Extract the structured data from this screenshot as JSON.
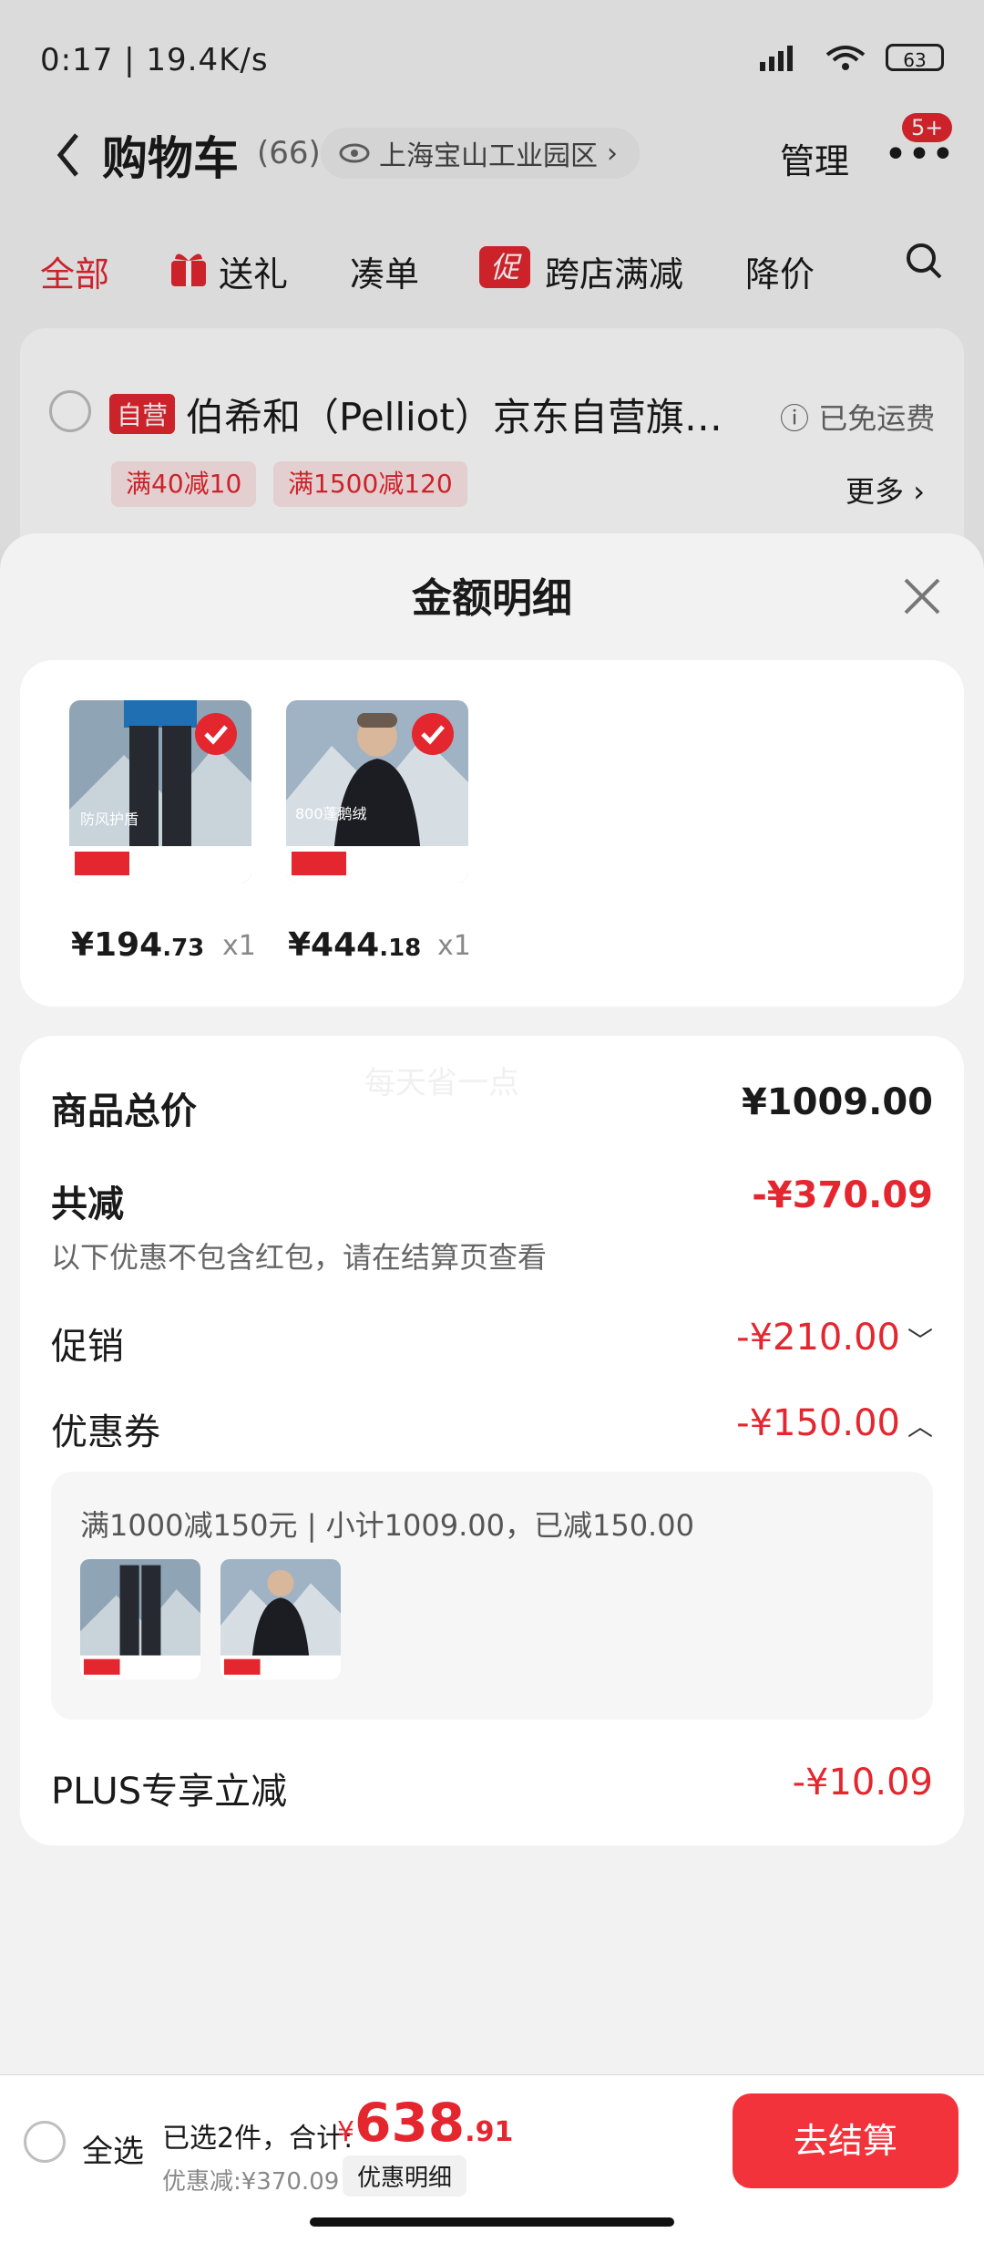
{
  "status_bar": {
    "time_speed": "0:17 | 19.4K/s",
    "battery": "63"
  },
  "header": {
    "title": "购物车",
    "count": "(66)",
    "address": "上海宝山工业园区",
    "manage": "管理",
    "badge": "5+"
  },
  "tabs": [
    "全部",
    "送礼",
    "凑单",
    "跨店满减",
    "降价"
  ],
  "promo_icon_text": "促",
  "store": {
    "tag": "自营",
    "name": "伯希和（Pelliot）京东自营旗…",
    "shipping": "已免运费",
    "chips": [
      "满40减10",
      "满1500减120"
    ],
    "more": "更多"
  },
  "sheet": {
    "title": "金额明细",
    "products": [
      {
        "price_int": "¥194",
        "price_dec": ".73",
        "qty": "x1"
      },
      {
        "price_int": "¥444",
        "price_dec": ".18",
        "qty": "x1"
      }
    ],
    "total_label": "商品总价",
    "total_value": "¥1009.00",
    "reduce_label": "共减",
    "reduce_value": "-¥370.09",
    "note": "以下优惠不包含红包，请在结算页查看",
    "promo_label": "促销",
    "promo_value": "-¥210.00",
    "coupon_label": "优惠券",
    "coupon_value": "-¥150.00",
    "coupon_detail": "满1000减150元 | 小计1009.00，已减150.00",
    "plus_label": "PLUS专享立减",
    "plus_value": "-¥10.09",
    "watermark": "每天省一点"
  },
  "bottom": {
    "select_all": "全选",
    "selected": "已选2件，合计:",
    "currency": "¥",
    "total_int": "638",
    "total_dec": ".91",
    "discount": "优惠减:¥370.09",
    "detail_btn": "优惠明细",
    "checkout": "去结算"
  },
  "colors": {
    "accent": "#e4262f"
  },
  "icons": [
    "back-icon",
    "eye-icon",
    "more-dots-icon",
    "gift-icon",
    "search-icon",
    "info-icon",
    "close-icon",
    "check-icon",
    "chevron-down-icon",
    "chevron-up-icon"
  ]
}
